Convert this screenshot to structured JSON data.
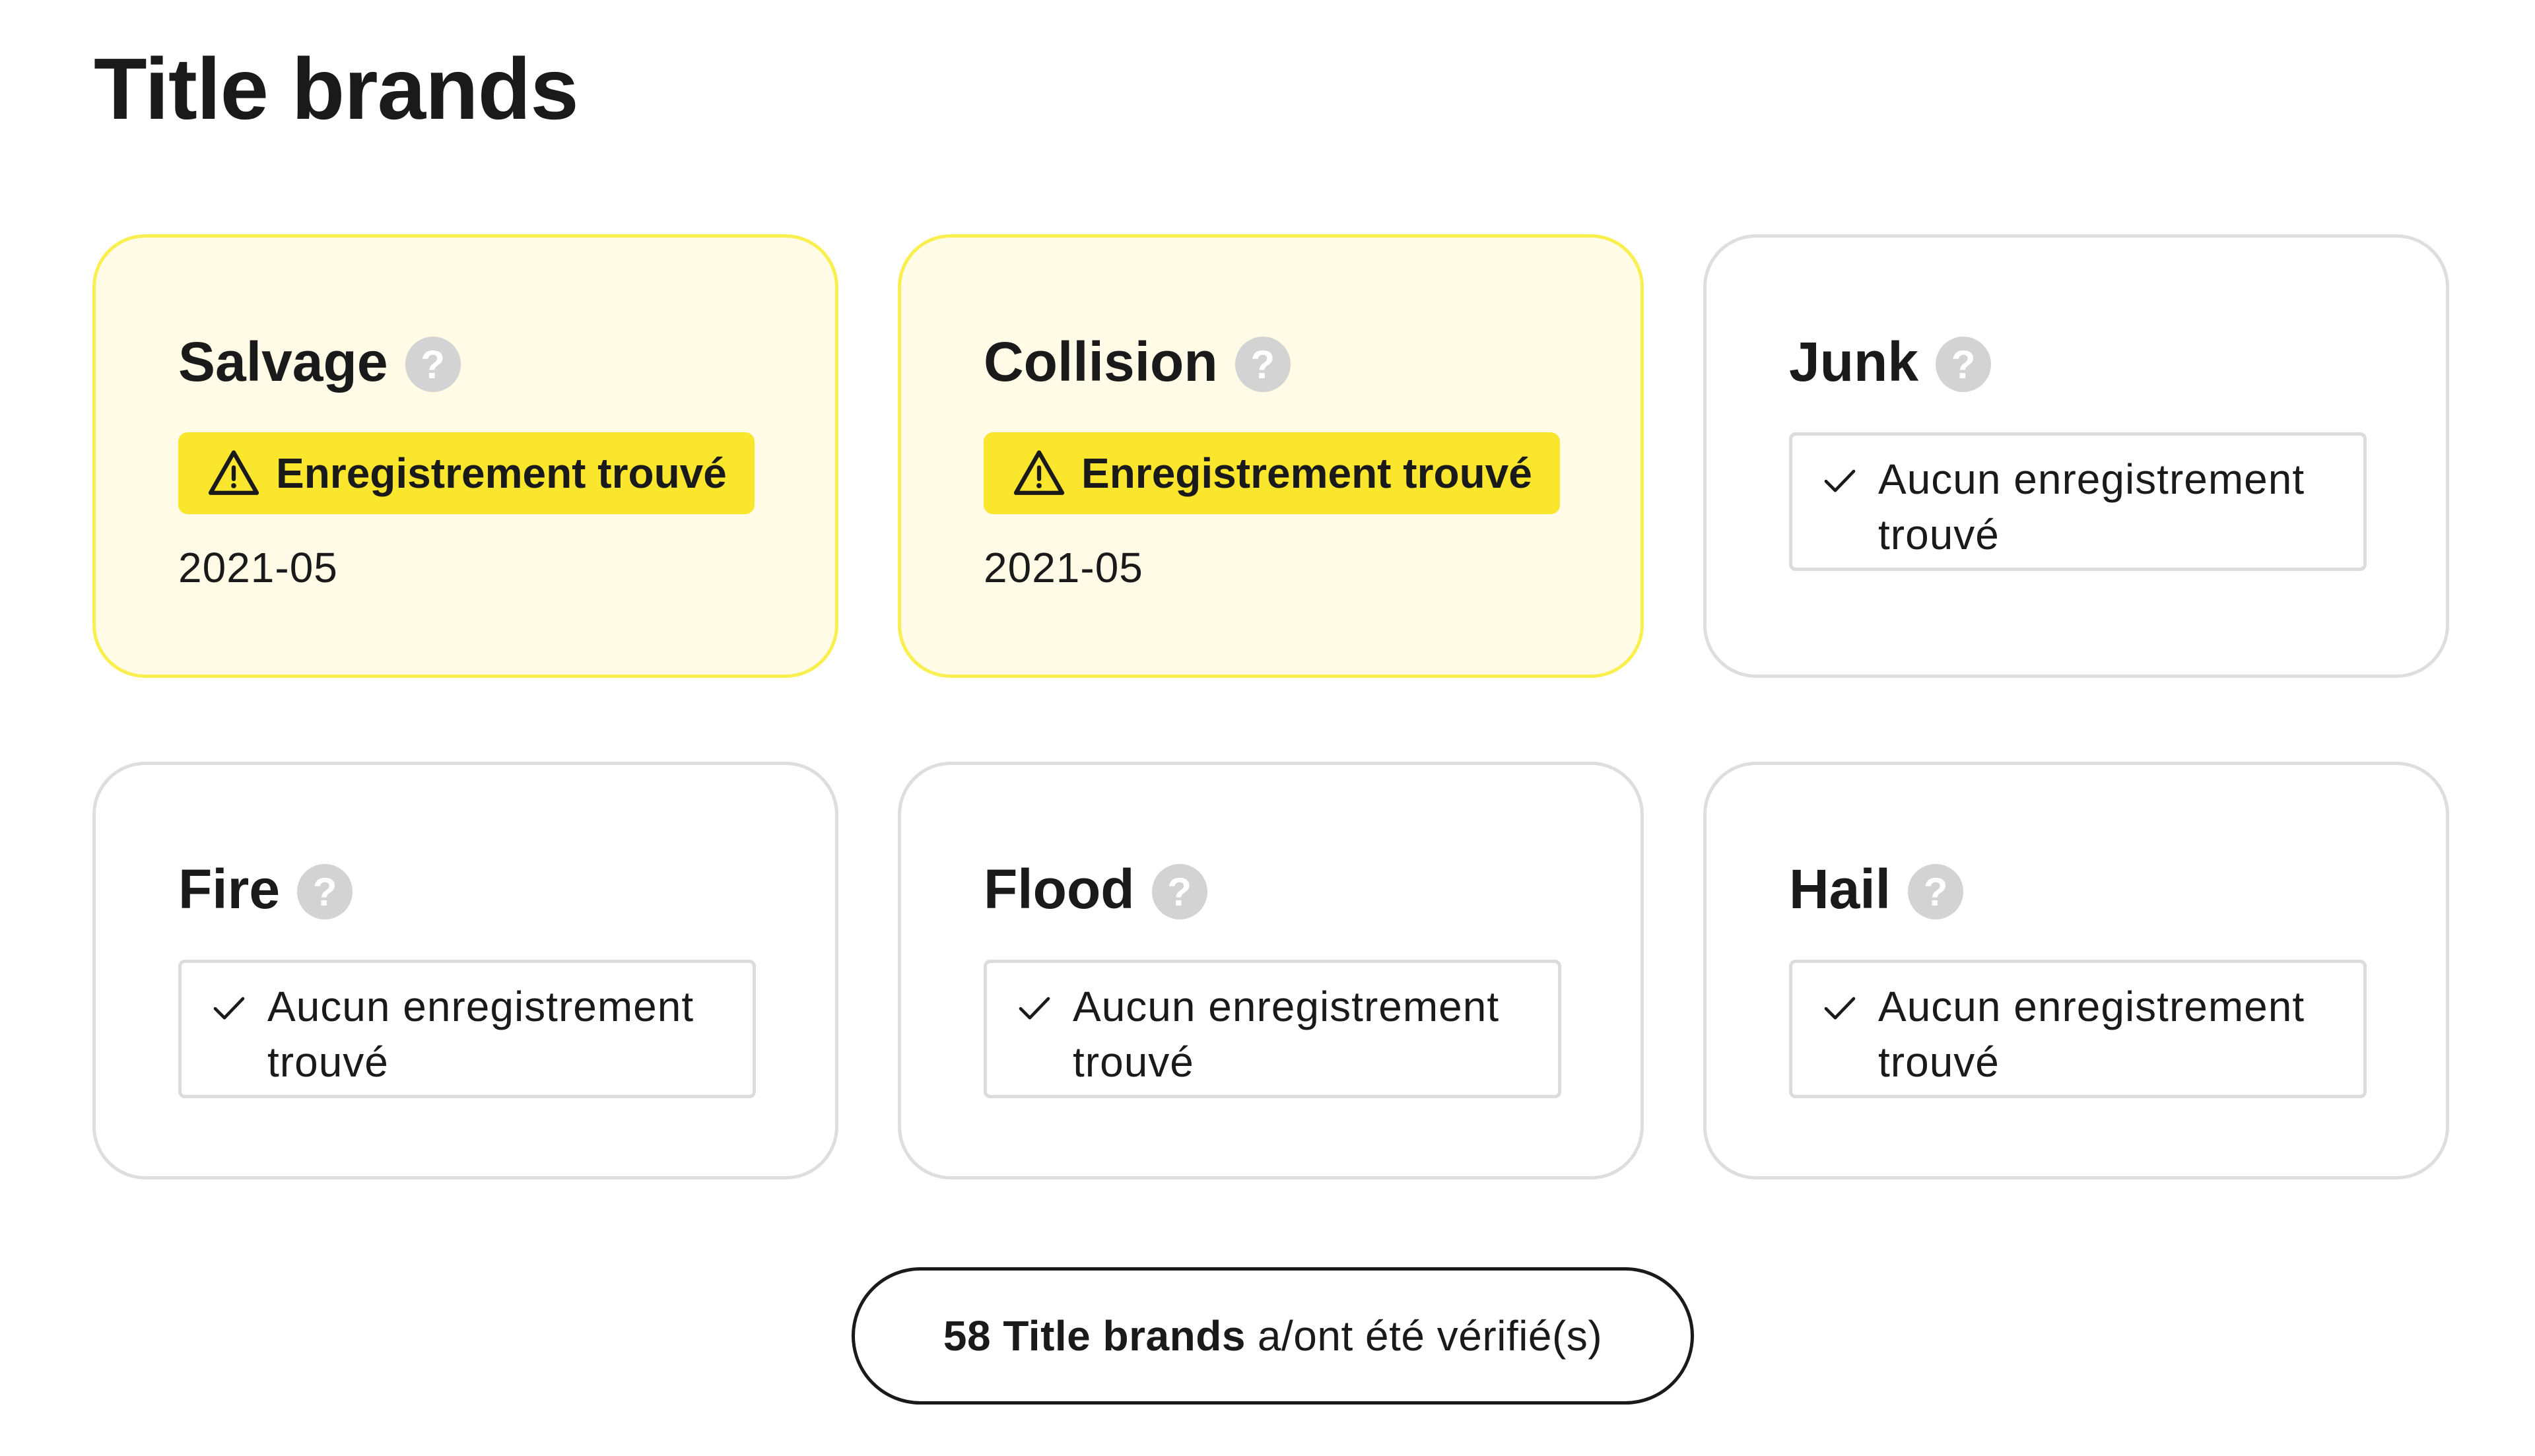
{
  "page": {
    "title": "Title brands"
  },
  "colors": {
    "found_background": "#fffbe6",
    "found_border": "#f9ef4f",
    "warning_badge": "#fae72d",
    "neutral_border": "#dedede",
    "help_icon": "#d3d3d3"
  },
  "cards": [
    {
      "name": "Salvage",
      "status": "found",
      "badge_label": "Enregistrement trouvé",
      "date": "2021-05",
      "help_icon": "question-icon",
      "status_icon": "warning-icon"
    },
    {
      "name": "Collision",
      "status": "found",
      "badge_label": "Enregistrement trouvé",
      "date": "2021-05",
      "help_icon": "question-icon",
      "status_icon": "warning-icon"
    },
    {
      "name": "Junk",
      "status": "not_found",
      "message": "Aucun enregistrement trouvé",
      "help_icon": "question-icon",
      "status_icon": "check-icon"
    },
    {
      "name": "Fire",
      "status": "not_found",
      "message": "Aucun enregistrement trouvé",
      "help_icon": "question-icon",
      "status_icon": "check-icon"
    },
    {
      "name": "Flood",
      "status": "not_found",
      "message": "Aucun enregistrement trouvé",
      "help_icon": "question-icon",
      "status_icon": "check-icon"
    },
    {
      "name": "Hail",
      "status": "not_found",
      "message": "Aucun enregistrement trouvé",
      "help_icon": "question-icon",
      "status_icon": "check-icon"
    }
  ],
  "help_glyph": "?",
  "summary": {
    "count_label": "58 Title brands",
    "suffix": "a/ont été vérifié(s)"
  }
}
